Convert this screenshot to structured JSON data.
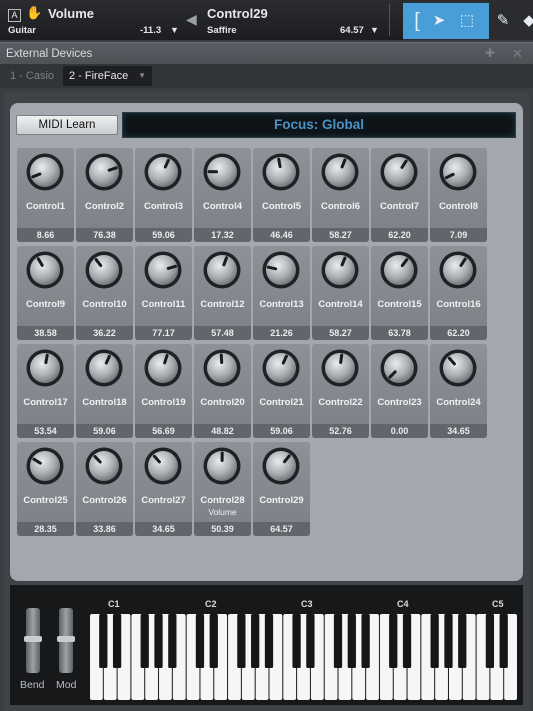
{
  "toolbar": {
    "a_badge": "A",
    "volume_title": "Volume",
    "volume_track": "Guitar",
    "volume_value": "-11.3",
    "control_title": "Control29",
    "control_device": "Saffire",
    "control_value": "64.57"
  },
  "panel": {
    "title": "External Devices",
    "tabs": [
      "1 - Casio",
      "2 - FireFace"
    ]
  },
  "midi_learn_label": "MIDI Learn",
  "focus_label": "Focus: Global",
  "controls": [
    {
      "name": "Control1",
      "value": "8.66"
    },
    {
      "name": "Control2",
      "value": "76.38"
    },
    {
      "name": "Control3",
      "value": "59.06"
    },
    {
      "name": "Control4",
      "value": "17.32"
    },
    {
      "name": "Control5",
      "value": "46.46"
    },
    {
      "name": "Control6",
      "value": "58.27"
    },
    {
      "name": "Control7",
      "value": "62.20"
    },
    {
      "name": "Control8",
      "value": "7.09"
    },
    {
      "name": "Control9",
      "value": "38.58"
    },
    {
      "name": "Control10",
      "value": "36.22"
    },
    {
      "name": "Control11",
      "value": "77.17"
    },
    {
      "name": "Control12",
      "value": "57.48"
    },
    {
      "name": "Control13",
      "value": "21.26"
    },
    {
      "name": "Control14",
      "value": "58.27"
    },
    {
      "name": "Control15",
      "value": "63.78"
    },
    {
      "name": "Control16",
      "value": "62.20"
    },
    {
      "name": "Control17",
      "value": "53.54"
    },
    {
      "name": "Control18",
      "value": "59.06"
    },
    {
      "name": "Control19",
      "value": "56.69"
    },
    {
      "name": "Control20",
      "value": "48.82"
    },
    {
      "name": "Control21",
      "value": "59.06"
    },
    {
      "name": "Control22",
      "value": "52.76"
    },
    {
      "name": "Control23",
      "value": "0.00"
    },
    {
      "name": "Control24",
      "value": "34.65"
    },
    {
      "name": "Control25",
      "value": "28.35"
    },
    {
      "name": "Control26",
      "value": "33.86"
    },
    {
      "name": "Control27",
      "value": "34.65"
    },
    {
      "name": "Control28",
      "value": "50.39",
      "sub": "Volume"
    },
    {
      "name": "Control29",
      "value": "64.57"
    }
  ],
  "keyboard": {
    "octave_labels": [
      "C1",
      "C2",
      "C3",
      "C4",
      "C5"
    ],
    "wheels": [
      "Bend",
      "Mod"
    ]
  },
  "colors": {
    "accent": "#4a9ed8",
    "focus_text": "#4a93c6"
  }
}
